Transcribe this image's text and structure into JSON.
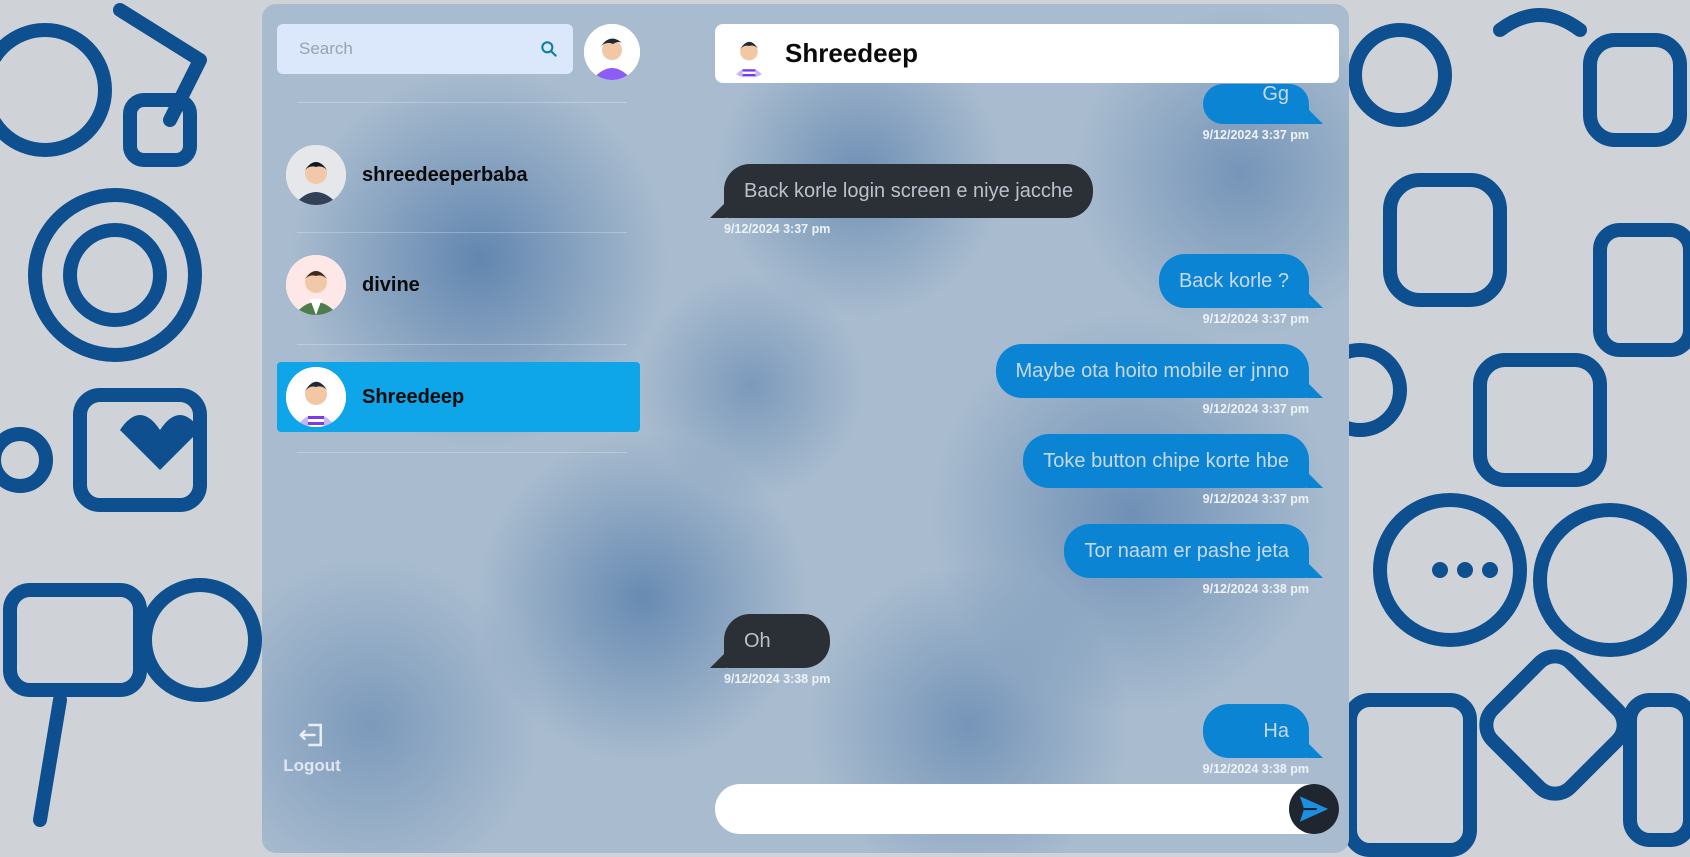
{
  "sidebar": {
    "search": {
      "placeholder": "Search"
    },
    "contacts": [
      {
        "name": "shreedeeperbaba"
      },
      {
        "name": "divine"
      },
      {
        "name": "Shreedeep"
      }
    ],
    "logout_label": "Logout"
  },
  "chat": {
    "header": {
      "title": "Shreedeep"
    },
    "messages": [
      {
        "text": "Gg",
        "time": "9/12/2024 3:37 pm",
        "dir": "out"
      },
      {
        "text": "Back korle login screen e niye jacche",
        "time": "9/12/2024 3:37 pm",
        "dir": "in"
      },
      {
        "text": "Back korle ?",
        "time": "9/12/2024 3:37 pm",
        "dir": "out"
      },
      {
        "text": "Maybe ota hoito mobile er jnno",
        "time": "9/12/2024 3:37 pm",
        "dir": "out"
      },
      {
        "text": "Toke button chipe korte hbe",
        "time": "9/12/2024 3:37 pm",
        "dir": "out"
      },
      {
        "text": "Tor naam er pashe jeta",
        "time": "9/12/2024 3:38 pm",
        "dir": "out"
      },
      {
        "text": "Oh",
        "time": "9/12/2024 3:38 pm",
        "dir": "in"
      },
      {
        "text": "Ha",
        "time": "9/12/2024 3:38 pm",
        "dir": "out"
      }
    ],
    "input": {
      "value": ""
    }
  },
  "colors": {
    "accent": "#0ea5e9",
    "outgoing_bubble": "#0b84d4",
    "incoming_bubble": "#2b2f36",
    "background_doodle": "#0d4f8f"
  },
  "icons": {
    "search": "search-icon",
    "logout": "logout-icon",
    "send": "send-icon"
  }
}
